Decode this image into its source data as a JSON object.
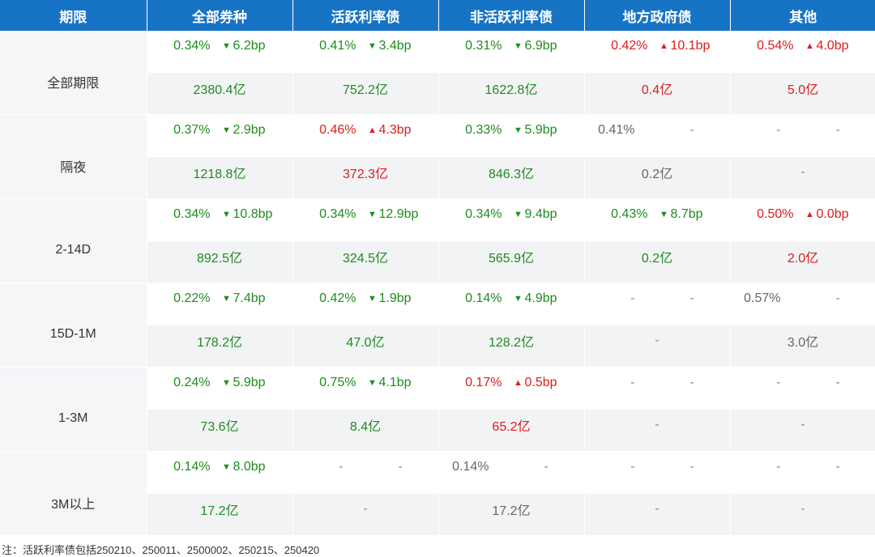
{
  "headers": [
    "期限",
    "全部券种",
    "活跃利率债",
    "非活跃利率债",
    "地方政府债",
    "其他"
  ],
  "rows": [
    {
      "period": "全部期限",
      "rates": [
        {
          "rate": "0.34%",
          "dir": "down",
          "chg": "6.2bp",
          "color": "green"
        },
        {
          "rate": "0.41%",
          "dir": "down",
          "chg": "3.4bp",
          "color": "green"
        },
        {
          "rate": "0.31%",
          "dir": "down",
          "chg": "6.9bp",
          "color": "green"
        },
        {
          "rate": "0.42%",
          "dir": "up",
          "chg": "10.1bp",
          "color": "red"
        },
        {
          "rate": "0.54%",
          "dir": "up",
          "chg": "4.0bp",
          "color": "red"
        }
      ],
      "amounts": [
        {
          "text": "2380.4亿",
          "color": "green"
        },
        {
          "text": "752.2亿",
          "color": "green"
        },
        {
          "text": "1622.8亿",
          "color": "green"
        },
        {
          "text": "0.4亿",
          "color": "red"
        },
        {
          "text": "5.0亿",
          "color": "red"
        }
      ]
    },
    {
      "period": "隔夜",
      "rates": [
        {
          "rate": "0.37%",
          "dir": "down",
          "chg": "2.9bp",
          "color": "green"
        },
        {
          "rate": "0.46%",
          "dir": "up",
          "chg": "4.3bp",
          "color": "red"
        },
        {
          "rate": "0.33%",
          "dir": "down",
          "chg": "5.9bp",
          "color": "green"
        },
        {
          "rate": "0.41%",
          "dir": "none",
          "chg": "-",
          "color": "gray"
        },
        {
          "rate": "-",
          "dir": "none",
          "chg": "-",
          "color": "dash"
        }
      ],
      "amounts": [
        {
          "text": "1218.8亿",
          "color": "green"
        },
        {
          "text": "372.3亿",
          "color": "red"
        },
        {
          "text": "846.3亿",
          "color": "green"
        },
        {
          "text": "0.2亿",
          "color": "gray"
        },
        {
          "text": "-",
          "color": "dash"
        }
      ]
    },
    {
      "period": "2-14D",
      "rates": [
        {
          "rate": "0.34%",
          "dir": "down",
          "chg": "10.8bp",
          "color": "green"
        },
        {
          "rate": "0.34%",
          "dir": "down",
          "chg": "12.9bp",
          "color": "green"
        },
        {
          "rate": "0.34%",
          "dir": "down",
          "chg": "9.4bp",
          "color": "green"
        },
        {
          "rate": "0.43%",
          "dir": "down",
          "chg": "8.7bp",
          "color": "green"
        },
        {
          "rate": "0.50%",
          "dir": "up",
          "chg": "0.0bp",
          "color": "red"
        }
      ],
      "amounts": [
        {
          "text": "892.5亿",
          "color": "green"
        },
        {
          "text": "324.5亿",
          "color": "green"
        },
        {
          "text": "565.9亿",
          "color": "green"
        },
        {
          "text": "0.2亿",
          "color": "green"
        },
        {
          "text": "2.0亿",
          "color": "red"
        }
      ]
    },
    {
      "period": "15D-1M",
      "rates": [
        {
          "rate": "0.22%",
          "dir": "down",
          "chg": "7.4bp",
          "color": "green"
        },
        {
          "rate": "0.42%",
          "dir": "down",
          "chg": "1.9bp",
          "color": "green"
        },
        {
          "rate": "0.14%",
          "dir": "down",
          "chg": "4.9bp",
          "color": "green"
        },
        {
          "rate": "-",
          "dir": "none",
          "chg": "-",
          "color": "dash"
        },
        {
          "rate": "0.57%",
          "dir": "none",
          "chg": "-",
          "color": "gray"
        }
      ],
      "amounts": [
        {
          "text": "178.2亿",
          "color": "green"
        },
        {
          "text": "47.0亿",
          "color": "green"
        },
        {
          "text": "128.2亿",
          "color": "green"
        },
        {
          "text": "-",
          "color": "dash"
        },
        {
          "text": "3.0亿",
          "color": "gray"
        }
      ]
    },
    {
      "period": "1-3M",
      "rates": [
        {
          "rate": "0.24%",
          "dir": "down",
          "chg": "5.9bp",
          "color": "green"
        },
        {
          "rate": "0.75%",
          "dir": "down",
          "chg": "4.1bp",
          "color": "green"
        },
        {
          "rate": "0.17%",
          "dir": "up",
          "chg": "0.5bp",
          "color": "red"
        },
        {
          "rate": "-",
          "dir": "none",
          "chg": "-",
          "color": "dash"
        },
        {
          "rate": "-",
          "dir": "none",
          "chg": "-",
          "color": "dash"
        }
      ],
      "amounts": [
        {
          "text": "73.6亿",
          "color": "green"
        },
        {
          "text": "8.4亿",
          "color": "green"
        },
        {
          "text": "65.2亿",
          "color": "red"
        },
        {
          "text": "-",
          "color": "dash"
        },
        {
          "text": "-",
          "color": "dash"
        }
      ]
    },
    {
      "period": "3M以上",
      "rates": [
        {
          "rate": "0.14%",
          "dir": "down",
          "chg": "8.0bp",
          "color": "green"
        },
        {
          "rate": "-",
          "dir": "none",
          "chg": "-",
          "color": "dash"
        },
        {
          "rate": "0.14%",
          "dir": "none",
          "chg": "-",
          "color": "gray"
        },
        {
          "rate": "-",
          "dir": "none",
          "chg": "-",
          "color": "dash"
        },
        {
          "rate": "-",
          "dir": "none",
          "chg": "-",
          "color": "dash"
        }
      ],
      "amounts": [
        {
          "text": "17.2亿",
          "color": "green"
        },
        {
          "text": "-",
          "color": "dash"
        },
        {
          "text": "17.2亿",
          "color": "gray"
        },
        {
          "text": "-",
          "color": "dash"
        },
        {
          "text": "-",
          "color": "dash"
        }
      ]
    }
  ],
  "note": "注：活跃利率债包括250210、250011、2500002、250215、250420",
  "colors": {
    "header_bg": "#1773c4",
    "up": "#dd1c1c",
    "down": "#1e8c1e",
    "neutral": "#666666"
  },
  "icons": {
    "up": "triangle-up-icon",
    "down": "triangle-down-icon"
  }
}
